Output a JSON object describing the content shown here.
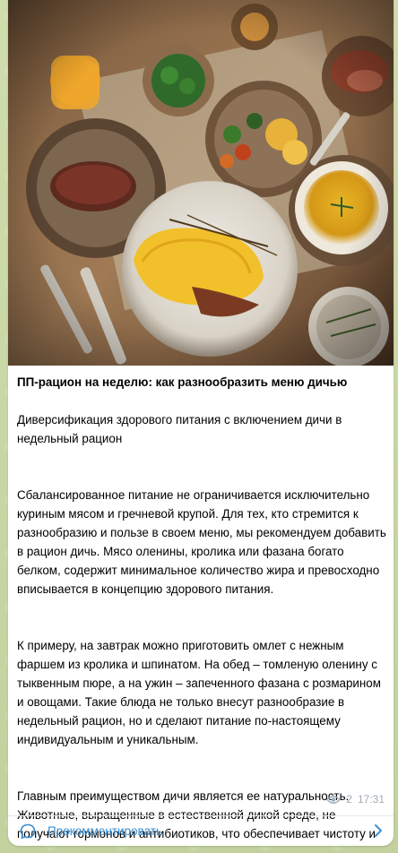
{
  "post": {
    "title": "ПП-рацион на неделю: как разнообразить меню дичью",
    "subtitle": "Диверсификация здорового питания с включением дичи в недельный рацион",
    "paragraphs": [
      "Сбалансированное питание не ограничивается исключительно куриным мясом и гречневой крупой. Для тех, кто стремится к разнообразию и пользе в своем меню, мы рекомендуем добавить в рацион дичь. Мясо оленины, кролика или фазана богато белком, содержит минимальное количество жира и превосходно вписывается в концепцию здорового питания.",
      "К примеру, на завтрак можно приготовить омлет с нежным фаршем из кролика и шпинатом. На обед – томленую оленину с тыквенным пюре, а на ужин – запеченного фазана с розмарином и овощами. Такие блюда не только внесут разнообразие в недельный рацион, но и сделают питание по-настоящему индивидуальным и уникальным.",
      "Главным преимуществом дичи является ее натуральность. Животные, выращенные в естественной дикой среде, не получают гормонов и антибиотиков, что обеспечивает чистоту и пользу мяса. Если ранее вы не имели опыта приготовления блюд из дичи, настал..."
    ],
    "views": "2",
    "time": "17:31"
  },
  "comments": {
    "label": "Прокомментировать",
    "icon": "comment-icon"
  },
  "colors": {
    "accent": "#3a8fd2",
    "meta": "#a0acb6",
    "bubble": "#ffffff",
    "wallpaper": "#c9d6a8"
  },
  "icons": [
    "eye-icon",
    "comment-icon",
    "chevron-right-icon"
  ]
}
